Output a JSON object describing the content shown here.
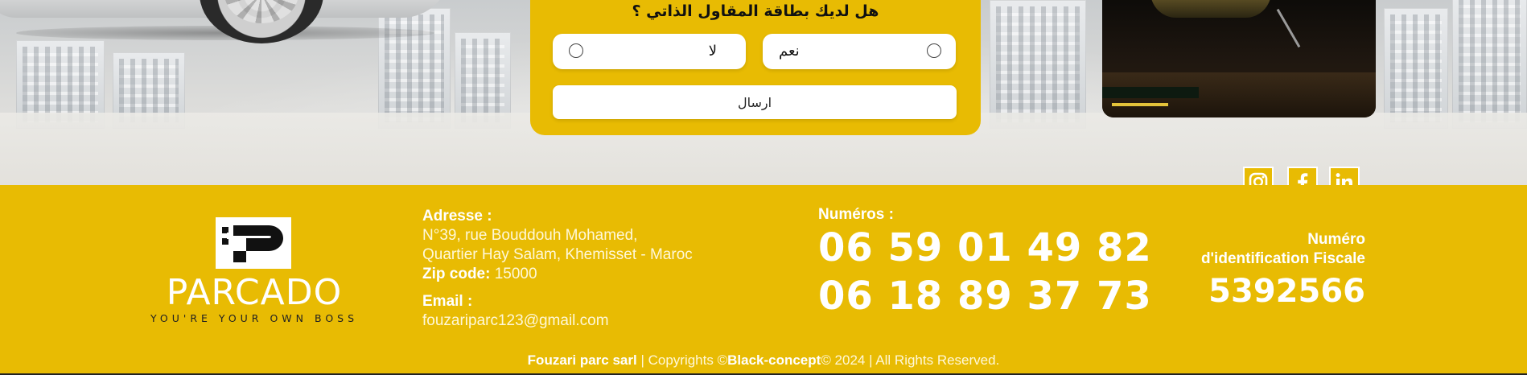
{
  "form": {
    "question": "هل لديك بطاقة المقاول الذاتي ؟",
    "option_yes": "نعم",
    "option_no": "لا",
    "submit_label": "ارسال"
  },
  "social": {
    "icons": [
      "instagram-icon",
      "facebook-icon",
      "linkedin-icon"
    ]
  },
  "footer": {
    "logo_text": "PARCADO",
    "logo_tagline": "YOU'RE YOUR OWN BOSS",
    "address_label": "Adresse :",
    "address_line1": "N°39, rue Bouddouh Mohamed,",
    "address_line2": "Quartier Hay Salam, Khemisset - Maroc",
    "zip_label": "Zip code:",
    "zip_value": "15000",
    "email_label": "Email :",
    "email_value": "fouzariparc123@gmail.com",
    "numbers_label": "Numéros :",
    "phone1": "06 59 01 49 82",
    "phone2": "06 18 89 37 73",
    "fiscal_label_line1": "Numéro",
    "fiscal_label_line2": "d'identification Fiscale",
    "fiscal_number": "5392566",
    "copyright_company": "Fouzari parc sarl",
    "copyright_text1": " | Copyrights ©",
    "copyright_agency": "Black-concept",
    "copyright_text2": "© 2024 | All Rights Reserved."
  },
  "colors": {
    "brand_yellow": "#e8bb03",
    "text_white": "#ffffff"
  }
}
